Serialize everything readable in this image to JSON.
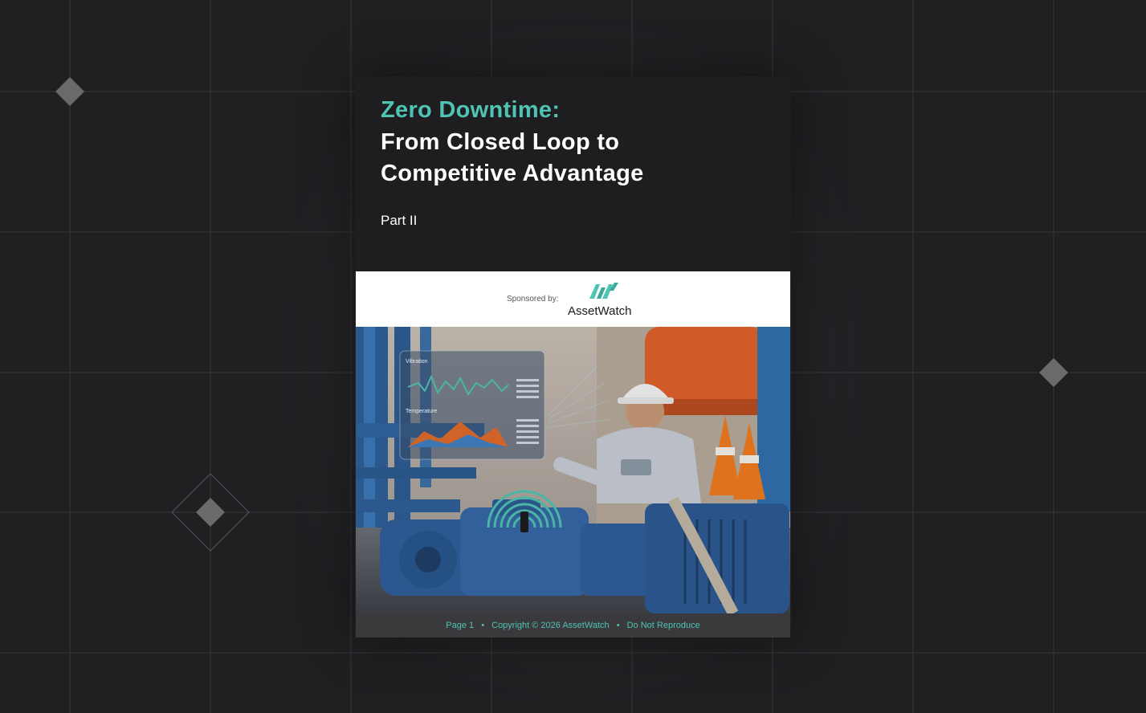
{
  "cover": {
    "title_accent": "Zero Downtime:",
    "title_line2": "From Closed Loop to",
    "title_line3": "Competitive Advantage",
    "part": "Part II"
  },
  "sponsor": {
    "label": "Sponsored by:",
    "brand": "AssetWatch"
  },
  "photo": {
    "hud_vibration_label": "Vibration",
    "hud_temperature_label": "Temperature"
  },
  "footer": {
    "page": "Page 1",
    "copyright": "Copyright © 2026 AssetWatch",
    "notice": "Do Not Reproduce",
    "separator": "•"
  },
  "colors": {
    "accent": "#4fc3b4",
    "background": "#201f22",
    "header": "#1e1d20",
    "footer": "#3a393c"
  }
}
